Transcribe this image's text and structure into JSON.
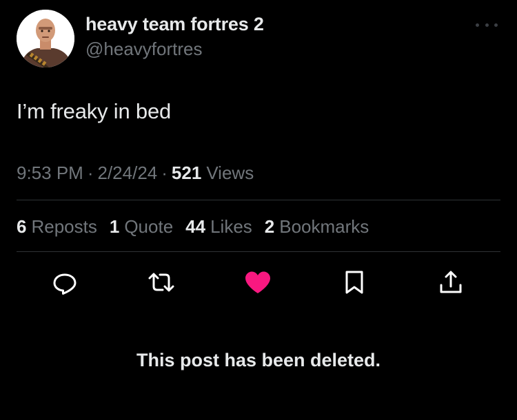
{
  "author": {
    "display_name": "heavy team fortres 2",
    "handle": "@heavyfortres",
    "avatar_icon": "heavy-character-avatar"
  },
  "post": {
    "text": "I’m freaky in bed",
    "time": "9:53 PM",
    "date": "2/24/24",
    "separator": "·",
    "views_count": "521",
    "views_label": "Views"
  },
  "stats": [
    {
      "count": "6",
      "label": "Reposts"
    },
    {
      "count": "1",
      "label": "Quote"
    },
    {
      "count": "44",
      "label": "Likes"
    },
    {
      "count": "2",
      "label": "Bookmarks"
    }
  ],
  "actions": {
    "reply_icon": "speech-bubble-icon",
    "repost_icon": "repost-arrows-icon",
    "like_icon": "heart-icon",
    "like_active": true,
    "bookmark_icon": "bookmark-icon",
    "share_icon": "share-upload-icon"
  },
  "notice": {
    "deleted_text": "This post has been deleted."
  },
  "colors": {
    "background": "#000000",
    "primary_text": "#e7e9ea",
    "secondary_text": "#71767b",
    "divider": "#2f3336",
    "like_active": "#f91880"
  }
}
